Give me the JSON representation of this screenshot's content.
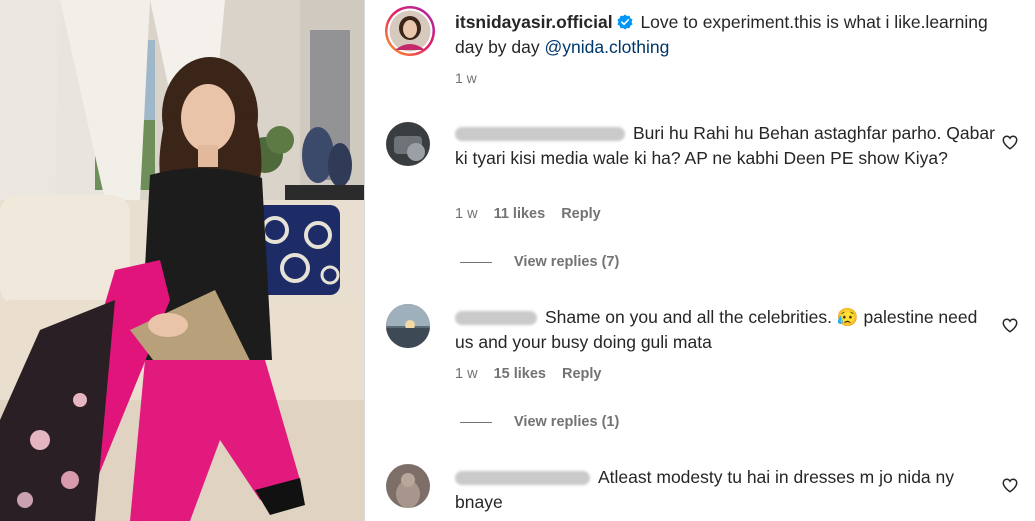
{
  "post": {
    "username": "itsnidayasir.official",
    "caption_text": "Love to experiment.this is what i like.learning day by day",
    "mention": "@ynida.clothing",
    "time": "1 w"
  },
  "comments": [
    {
      "text": "Buri hu Rahi hu Behan astaghfar parho. Qabar ki tyari kisi media wale ki ha? AP ne kabhi Deen PE show Kiya?",
      "time": "1 w",
      "likes": "11 likes",
      "reply_label": "Reply",
      "view_replies": "View replies (7)"
    },
    {
      "text": "Shame on you and all the celebrities. 😥 palestine need us and your busy doing guli mata",
      "time": "1 w",
      "likes": "15 likes",
      "reply_label": "Reply",
      "view_replies": "View replies (1)"
    },
    {
      "text": "Atleast modesty tu hai in dresses m jo nida ny bnaye"
    }
  ],
  "colors": {
    "accent_link": "#00376b",
    "verified": "#0095f6",
    "secondary_text": "#737373"
  },
  "icons": [
    "verified-badge-icon",
    "heart-icon"
  ]
}
